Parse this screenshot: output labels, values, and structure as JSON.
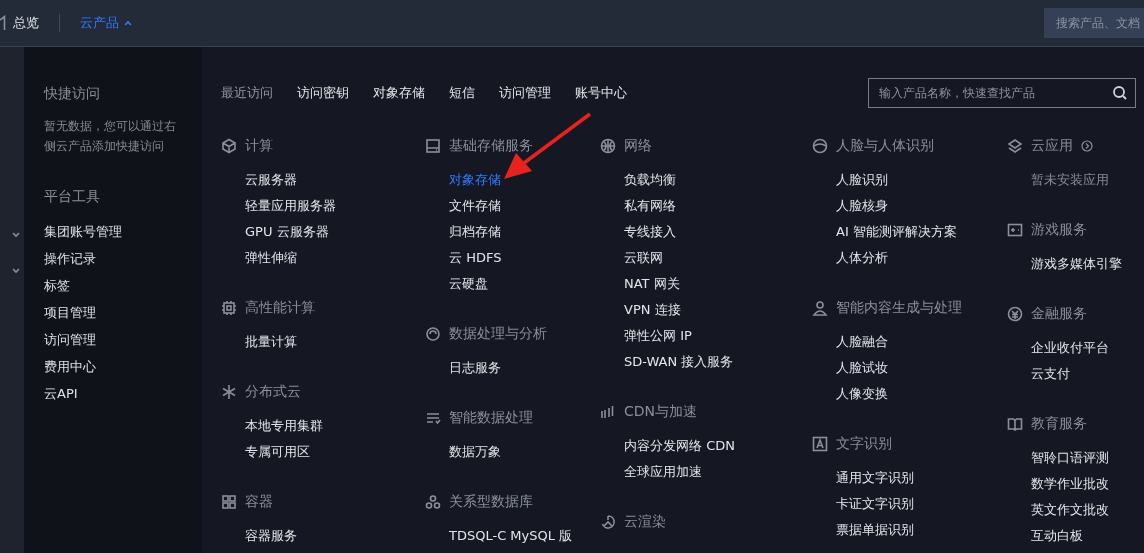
{
  "top_bar": {
    "nav": [
      {
        "label": "总览",
        "selected": false
      },
      {
        "label": "云产品",
        "selected": true
      }
    ],
    "search": {
      "placeholder": "搜索产品、文档"
    }
  },
  "quick_panel": {
    "title": "快捷访问",
    "empty_text": "暂无数据，您可以通过右侧云产品添加快捷访问",
    "tools_title": "平台工具",
    "tools": [
      "集团账号管理",
      "操作记录",
      "标签",
      "项目管理",
      "访问管理",
      "费用中心",
      "云API"
    ]
  },
  "product_menu": {
    "recent_label": "最近访问",
    "recent": [
      "访问密钥",
      "对象存储",
      "短信",
      "访问管理",
      "账号中心"
    ],
    "search": {
      "placeholder": "输入产品名称，快速查找产品"
    },
    "columns": [
      [
        {
          "title": "计算",
          "items": [
            {
              "label": "云服务器",
              "selected": false
            },
            {
              "label": "轻量应用服务器",
              "selected": false
            },
            {
              "label": "GPU 云服务器",
              "selected": false
            },
            {
              "label": "弹性伸缩",
              "selected": false
            }
          ]
        },
        {
          "title": "高性能计算",
          "items": [
            {
              "label": "批量计算",
              "selected": false
            }
          ]
        },
        {
          "title": "分布式云",
          "items": [
            {
              "label": "本地专用集群",
              "selected": false
            },
            {
              "label": "专属可用区",
              "selected": false
            }
          ]
        },
        {
          "title": "容器",
          "items": [
            {
              "label": "容器服务",
              "selected": false
            }
          ]
        }
      ],
      [
        {
          "title": "基础存储服务",
          "items": [
            {
              "label": "对象存储",
              "selected": true
            },
            {
              "label": "文件存储",
              "selected": false
            },
            {
              "label": "归档存储",
              "selected": false
            },
            {
              "label": "云 HDFS",
              "selected": false
            },
            {
              "label": "云硬盘",
              "selected": false
            }
          ]
        },
        {
          "title": "数据处理与分析",
          "items": [
            {
              "label": "日志服务",
              "selected": false
            }
          ]
        },
        {
          "title": "智能数据处理",
          "items": [
            {
              "label": "数据万象",
              "selected": false
            }
          ]
        },
        {
          "title": "关系型数据库",
          "items": [
            {
              "label": "TDSQL-C MySQL 版",
              "selected": false
            }
          ]
        }
      ],
      [
        {
          "title": "网络",
          "items": [
            {
              "label": "负载均衡",
              "selected": false
            },
            {
              "label": "私有网络",
              "selected": false
            },
            {
              "label": "专线接入",
              "selected": false
            },
            {
              "label": "云联网",
              "selected": false
            },
            {
              "label": "NAT 网关",
              "selected": false
            },
            {
              "label": "VPN 连接",
              "selected": false
            },
            {
              "label": "弹性公网 IP",
              "selected": false
            },
            {
              "label": "SD-WAN 接入服务",
              "selected": false
            }
          ]
        },
        {
          "title": "CDN与加速",
          "items": [
            {
              "label": "内容分发网络 CDN",
              "selected": false
            },
            {
              "label": "全球应用加速",
              "selected": false
            }
          ]
        },
        {
          "title": "云渲染"
        }
      ],
      [
        {
          "title": "人脸与人体识别",
          "items": [
            {
              "label": "人脸识别",
              "selected": false
            },
            {
              "label": "人脸核身",
              "selected": false
            },
            {
              "label": "AI 智能测评解决方案",
              "selected": false
            },
            {
              "label": "人体分析",
              "selected": false
            }
          ]
        },
        {
          "title": "智能内容生成与处理",
          "items": [
            {
              "label": "人脸融合",
              "selected": false
            },
            {
              "label": "人脸试妆",
              "selected": false
            },
            {
              "label": "人像变换",
              "selected": false
            }
          ]
        },
        {
          "title": "文字识别",
          "items": [
            {
              "label": "通用文字识别",
              "selected": false
            },
            {
              "label": "卡证文字识别",
              "selected": false
            },
            {
              "label": "票据单据识别",
              "selected": false
            }
          ]
        }
      ],
      [
        {
          "title": "云应用",
          "empty_text": "暂未安装应用"
        },
        {
          "title": "游戏服务",
          "items": [
            {
              "label": "游戏多媒体引擎",
              "selected": false
            }
          ]
        },
        {
          "title": "金融服务",
          "items": [
            {
              "label": "企业收付平台",
              "selected": false
            },
            {
              "label": "云支付",
              "selected": false
            }
          ]
        },
        {
          "title": "教育服务",
          "items": [
            {
              "label": "智聆口语评测",
              "selected": false
            },
            {
              "label": "数学作业批改",
              "selected": false
            },
            {
              "label": "英文作文批改",
              "selected": false
            },
            {
              "label": "互动白板",
              "selected": false
            }
          ]
        }
      ]
    ],
    "annotations": [
      {
        "kind": "arrow"
      }
    ]
  }
}
